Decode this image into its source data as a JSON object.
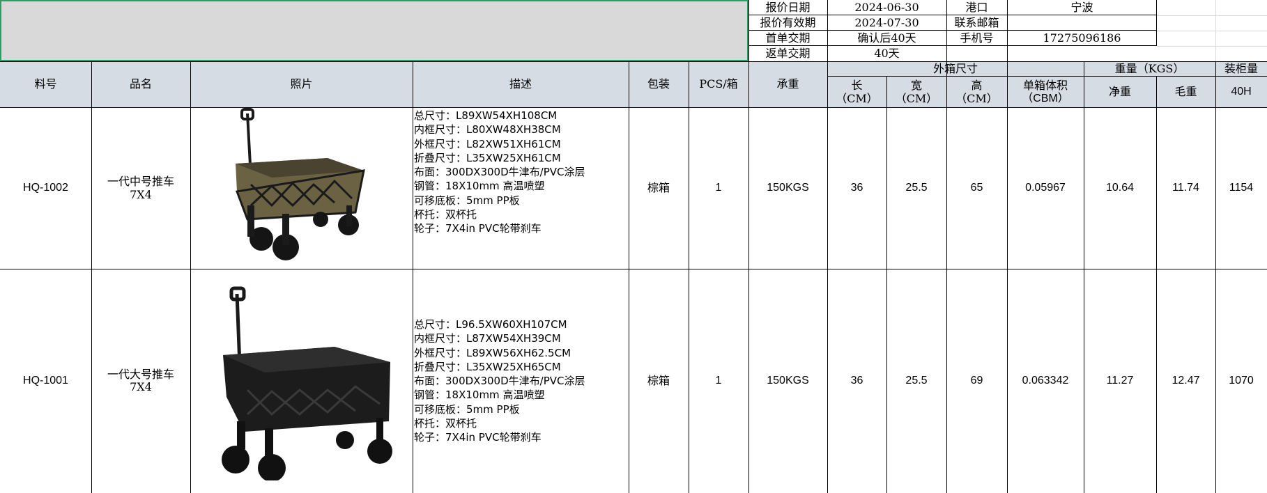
{
  "quote_info": {
    "quote_date_label": "报价日期",
    "quote_date": "2024-06-30",
    "valid_label": "报价有效期",
    "valid_date": "2024-07-30",
    "first_delivery_label": "首单交期",
    "first_delivery": "确认后40天",
    "repeat_delivery_label": "返单交期",
    "repeat_delivery": "40天",
    "port_label": "港口",
    "port": "宁波",
    "email_label": "联系邮箱",
    "email": "",
    "phone_label": "手机号",
    "phone": "17275096186"
  },
  "headers": {
    "part_no": "料号",
    "name": "品名",
    "photo": "照片",
    "desc": "描述",
    "packing": "包装",
    "pcs": "PCS/箱",
    "load": "承重",
    "carton_size": "外箱尺寸",
    "len1": "长",
    "len2": "（CM）",
    "wid1": "宽",
    "wid2": "（CM）",
    "hei1": "高",
    "hei2": "（CM）",
    "vol1": "单箱体积",
    "vol2": "（CBM）",
    "weight": "重量（KGS）",
    "net": "净重",
    "gross": "毛重",
    "container": "装柜量",
    "container_sub": "40H"
  },
  "rows": [
    {
      "part_no": "HQ-1002",
      "name1": "一代中号推车",
      "name2": "7X4",
      "desc": [
        "总尺寸：L89XW54XH108CM",
        "内框尺寸：L80XW48XH38CM",
        "外框尺寸：L82XW51XH61CM",
        "折叠尺寸：L35XW25XH61CM",
        "布面：300DX300D牛津布/PVC涂层",
        "钢管：18X10mm 高温喷塑",
        "可移底板：5mm PP板",
        "杯托：双杯托",
        "轮子：7X4in PVC轮带刹车"
      ],
      "packing": "棕箱",
      "pcs": "1",
      "load": "150KGS",
      "len": "36",
      "wid": "25.5",
      "hei": "65",
      "vol": "0.05967",
      "net": "10.64",
      "gross": "11.74",
      "container": "1154",
      "color": "#6b6243"
    },
    {
      "part_no": "HQ-1001",
      "name1": "一代大号推车",
      "name2": "7X4",
      "desc": [
        "总尺寸：L96.5XW60XH107CM",
        "内框尺寸：L87XW54XH39CM",
        "外框尺寸：L89XW56XH62.5CM",
        "折叠尺寸：L35XW25XH65CM",
        "布面：300DX300D牛津布/PVC涂层",
        "钢管：18X10mm 高温喷塑",
        "可移底板：5mm PP板",
        "杯托：双杯托",
        "轮子：7X4in PVC轮带刹车"
      ],
      "packing": "棕箱",
      "pcs": "1",
      "load": "150KGS",
      "len": "36",
      "wid": "25.5",
      "hei": "69",
      "vol": "0.063342",
      "net": "11.27",
      "gross": "12.47",
      "container": "1070",
      "color": "#1c1c1c"
    }
  ]
}
